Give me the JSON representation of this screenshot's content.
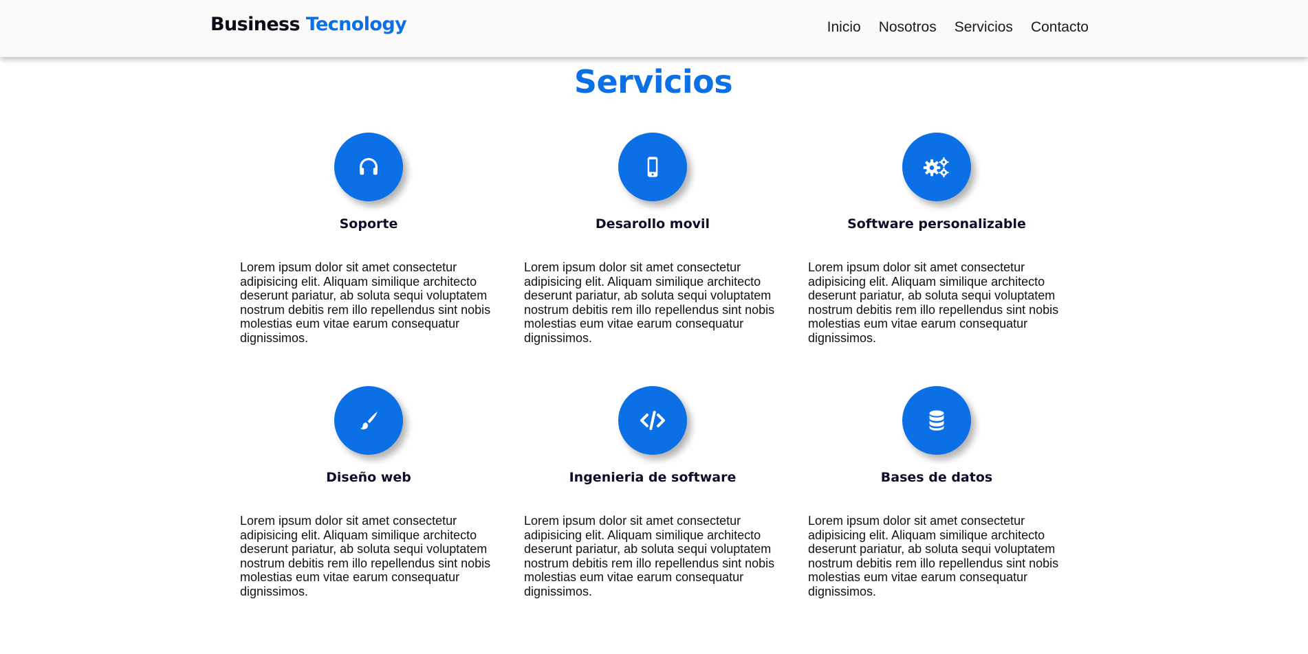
{
  "header": {
    "brand_part1": "Business",
    "brand_part2": "Tecnology",
    "nav": [
      "Inicio",
      "Nosotros",
      "Servicios",
      "Contacto"
    ]
  },
  "section": {
    "title": "Servicios"
  },
  "colors": {
    "accent": "#0b6fe6",
    "header_bg": "#fbfaf8",
    "title_text": "#0d0d2a"
  },
  "services": [
    {
      "icon": "headphones-icon",
      "title": "Soporte",
      "text": "Lorem ipsum dolor sit amet consectetur adipisicing elit. Aliquam similique architecto deserunt pariatur, ab soluta sequi voluptatem nostrum debitis rem illo repellendus sint nobis molestias eum vitae earum consequatur dignissimos."
    },
    {
      "icon": "mobile-phone-icon",
      "title": "Desarollo movil",
      "text": "Lorem ipsum dolor sit amet consectetur adipisicing elit. Aliquam similique architecto deserunt pariatur, ab soluta sequi voluptatem nostrum debitis rem illo repellendus sint nobis molestias eum vitae earum consequatur dignissimos."
    },
    {
      "icon": "gears-icon",
      "title": "Software personalizable",
      "text": "Lorem ipsum dolor sit amet consectetur adipisicing elit. Aliquam similique architecto deserunt pariatur, ab soluta sequi voluptatem nostrum debitis rem illo repellendus sint nobis molestias eum vitae earum consequatur dignissimos."
    },
    {
      "icon": "paint-brush-icon",
      "title": "Diseño web",
      "text": "Lorem ipsum dolor sit amet consectetur adipisicing elit. Aliquam similique architecto deserunt pariatur, ab soluta sequi voluptatem nostrum debitis rem illo repellendus sint nobis molestias eum vitae earum consequatur dignissimos."
    },
    {
      "icon": "code-icon",
      "title": "Ingenieria de software",
      "text": "Lorem ipsum dolor sit amet consectetur adipisicing elit. Aliquam similique architecto deserunt pariatur, ab soluta sequi voluptatem nostrum debitis rem illo repellendus sint nobis molestias eum vitae earum consequatur dignissimos."
    },
    {
      "icon": "database-icon",
      "title": "Bases de datos",
      "text": "Lorem ipsum dolor sit amet consectetur adipisicing elit. Aliquam similique architecto deserunt pariatur, ab soluta sequi voluptatem nostrum debitis rem illo repellendus sint nobis molestias eum vitae earum consequatur dignissimos."
    }
  ]
}
